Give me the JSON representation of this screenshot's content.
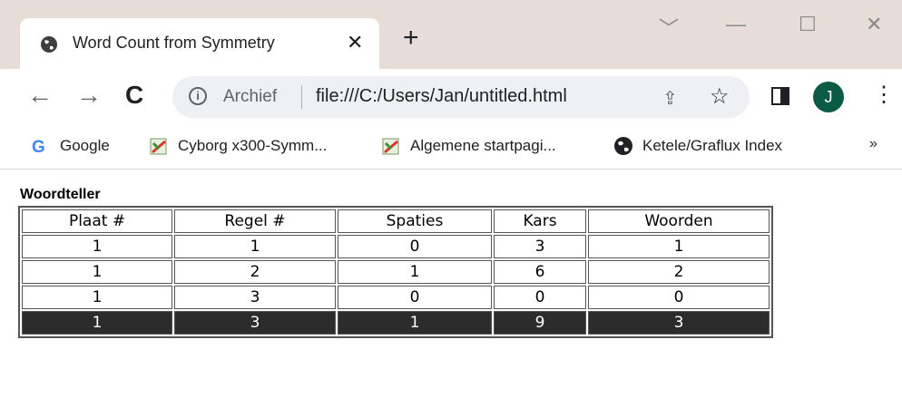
{
  "browser": {
    "tab": {
      "title": "Word Count from Symmetry",
      "close": "✕"
    },
    "new_tab": "+",
    "window_controls": {
      "chevron": "﹀",
      "minimize": "—",
      "maximize": "☐",
      "close": "✕"
    },
    "nav": {
      "back": "←",
      "forward": "→",
      "reload": "C"
    },
    "omnibox": {
      "chip": "Archief",
      "url": "file:///C:/Users/Jan/untitled.html"
    },
    "profile_initial": "J",
    "menu": "⋮",
    "bookmarks": [
      {
        "label": "Google",
        "icon": "google-icon"
      },
      {
        "label": "Cyborg x300-Symm...",
        "icon": "symmetry-favicon-icon"
      },
      {
        "label": "Algemene startpagi...",
        "icon": "symmetry-favicon-icon"
      },
      {
        "label": "Ketele/Graflux Index",
        "icon": "globe-icon"
      }
    ],
    "more_bookmarks": "»"
  },
  "page": {
    "heading": "Woordteller",
    "table": {
      "headers": [
        "Plaat #",
        "Regel #",
        "Spaties",
        "Kars",
        "Woorden"
      ],
      "rows": [
        [
          "1",
          "1",
          "0",
          "3",
          "1"
        ],
        [
          "1",
          "2",
          "1",
          "6",
          "2"
        ],
        [
          "1",
          "3",
          "0",
          "0",
          "0"
        ]
      ],
      "total": [
        "1",
        "3",
        "1",
        "9",
        "3"
      ]
    }
  },
  "colors": {
    "avatar": "#0b5a44",
    "titlebar": "#e6ddd9",
    "total_row": "#2c2c2c"
  }
}
